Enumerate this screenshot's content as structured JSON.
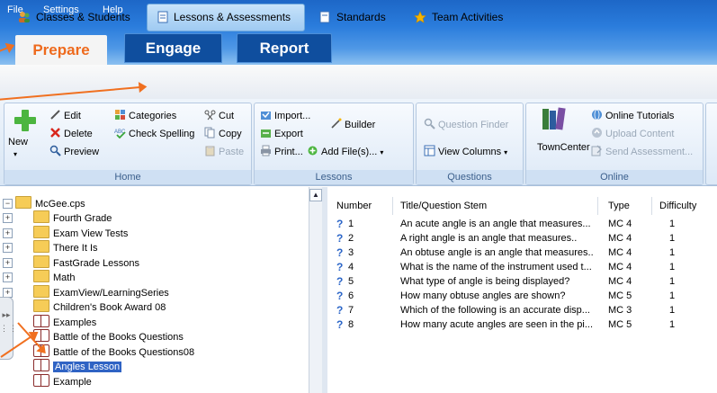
{
  "menu": [
    "File",
    "Settings",
    "Help"
  ],
  "main_tabs": [
    "Prepare",
    "Engage",
    "Report"
  ],
  "subnav": [
    "Classes & Students",
    "Lessons & Assessments",
    "Standards",
    "Team Activities"
  ],
  "ribbon": {
    "home": {
      "label": "Home",
      "new": "New",
      "edit": "Edit",
      "delete": "Delete",
      "preview": "Preview",
      "categories": "Categories",
      "check_spelling": "Check Spelling",
      "cut": "Cut",
      "copy": "Copy",
      "paste": "Paste"
    },
    "lessons": {
      "label": "Lessons",
      "import": "Import...",
      "export": "Export",
      "print": "Print...",
      "builder": "Builder",
      "add_files": "Add File(s)..."
    },
    "questions": {
      "label": "Questions",
      "question_finder": "Question Finder",
      "view_columns": "View Columns"
    },
    "online": {
      "label": "Online",
      "towncenter": "TownCenter",
      "online_tutorials": "Online Tutorials",
      "upload_content": "Upload Content",
      "send_assessment": "Send Assessment..."
    }
  },
  "tree": {
    "root": "McGee.cps",
    "items": [
      {
        "label": "Fourth Grade",
        "type": "folder",
        "expandable": true
      },
      {
        "label": "Exam View Tests",
        "type": "folder",
        "expandable": true
      },
      {
        "label": "There It Is",
        "type": "folder",
        "expandable": true
      },
      {
        "label": "FastGrade Lessons",
        "type": "folder",
        "expandable": true
      },
      {
        "label": "Math",
        "type": "folder",
        "expandable": true
      },
      {
        "label": "ExamView/LearningSeries",
        "type": "folder",
        "expandable": true
      },
      {
        "label": "Children's Book Award 08",
        "type": "folder",
        "expandable": false
      },
      {
        "label": "Examples",
        "type": "book",
        "expandable": true
      },
      {
        "label": "Battle of the Books Questions",
        "type": "book",
        "expandable": false
      },
      {
        "label": "Battle of the Books Questions08",
        "type": "book",
        "expandable": false
      },
      {
        "label": "Angles Lesson",
        "type": "book",
        "expandable": false,
        "selected": true
      },
      {
        "label": "Example",
        "type": "book",
        "expandable": false
      }
    ]
  },
  "list": {
    "columns": [
      "Number",
      "Title/Question Stem",
      "Type",
      "Difficulty"
    ],
    "rows": [
      {
        "number": "1",
        "title": "An acute angle is an angle that measures...",
        "type": "MC 4",
        "difficulty": "1"
      },
      {
        "number": "2",
        "title": "A right angle is an angle that measures..",
        "type": "MC 4",
        "difficulty": "1"
      },
      {
        "number": "3",
        "title": "An obtuse angle is an angle that measures..",
        "type": "MC 4",
        "difficulty": "1"
      },
      {
        "number": "4",
        "title": "What is the name of the instrument used t...",
        "type": "MC 4",
        "difficulty": "1"
      },
      {
        "number": "5",
        "title": "What type of angle is being displayed?",
        "type": "MC 4",
        "difficulty": "1"
      },
      {
        "number": "6",
        "title": "How many obtuse angles are shown?",
        "type": "MC 5",
        "difficulty": "1"
      },
      {
        "number": "7",
        "title": "Which of the following is an accurate disp...",
        "type": "MC 3",
        "difficulty": "1"
      },
      {
        "number": "8",
        "title": "How many acute angles are seen in the pi...",
        "type": "MC 5",
        "difficulty": "1"
      }
    ]
  },
  "colors": {
    "accent_orange": "#ee6a1d",
    "brand_blue": "#1d67c7",
    "selection": "#2f63c4"
  }
}
